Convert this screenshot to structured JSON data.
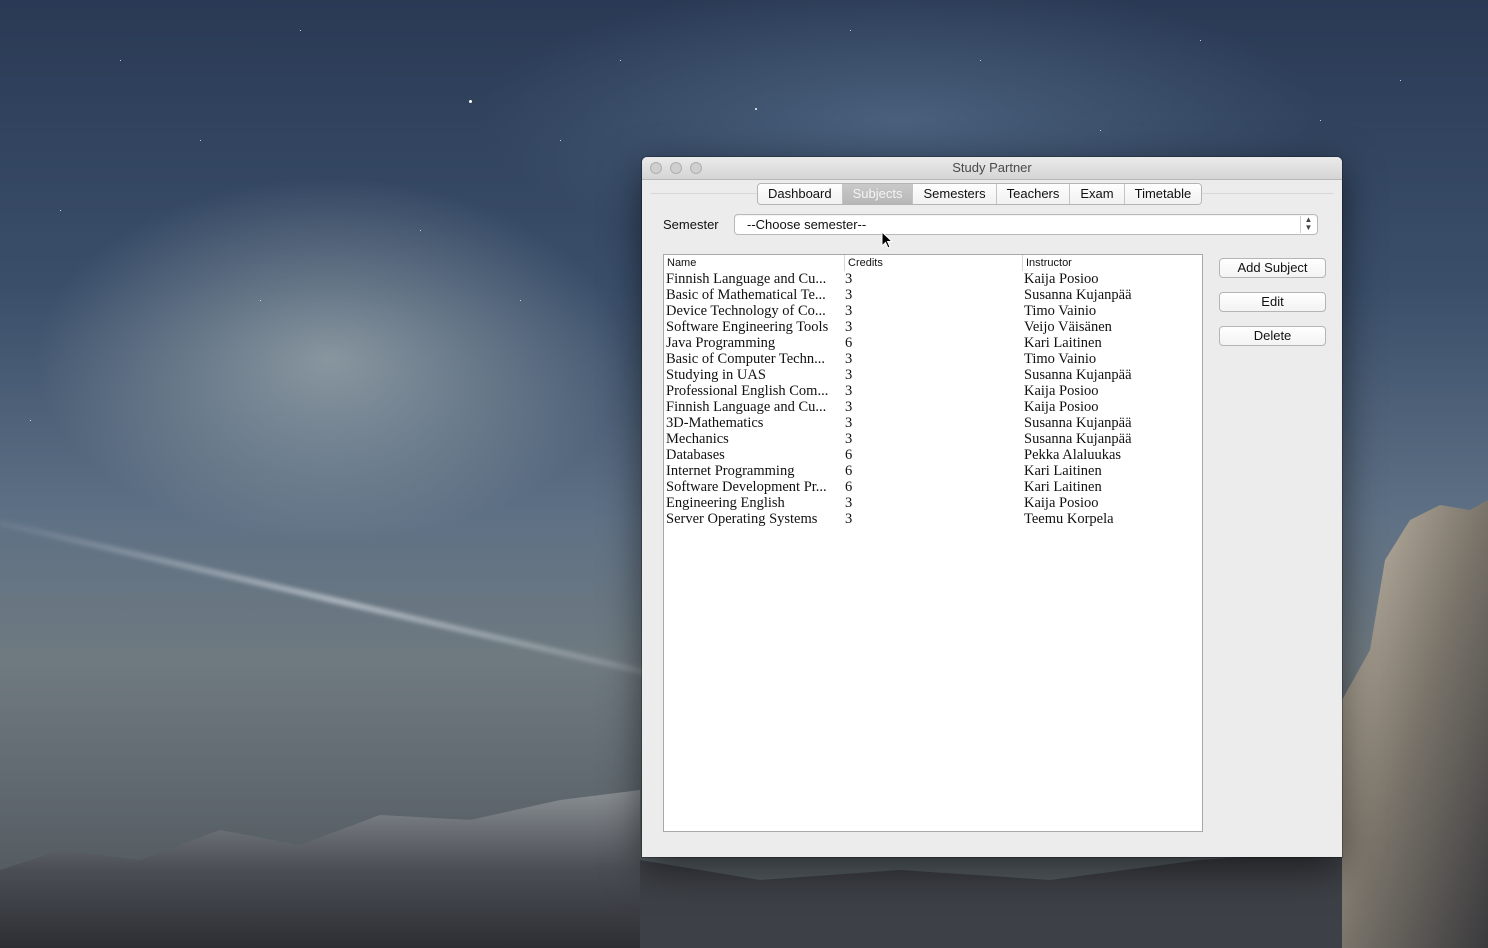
{
  "window": {
    "title": "Study Partner"
  },
  "tabs": [
    {
      "label": "Dashboard",
      "active": false
    },
    {
      "label": "Subjects",
      "active": true
    },
    {
      "label": "Semesters",
      "active": false
    },
    {
      "label": "Teachers",
      "active": false
    },
    {
      "label": "Exam",
      "active": false
    },
    {
      "label": "Timetable",
      "active": false
    }
  ],
  "semester": {
    "label": "Semester",
    "value": "--Choose semester--"
  },
  "table": {
    "headers": {
      "name": "Name",
      "credits": "Credits",
      "instructor": "Instructor"
    },
    "rows": [
      {
        "name": "Finnish Language and Cu...",
        "credits": "3",
        "instructor": "Kaija Posioo"
      },
      {
        "name": "Basic of Mathematical Te...",
        "credits": "3",
        "instructor": "Susanna Kujanpää"
      },
      {
        "name": "Device Technology of Co...",
        "credits": "3",
        "instructor": "Timo Vainio"
      },
      {
        "name": "Software Engineering Tools",
        "credits": "3",
        "instructor": "Veijo Väisänen"
      },
      {
        "name": "Java Programming",
        "credits": "6",
        "instructor": "Kari Laitinen"
      },
      {
        "name": "Basic of Computer Techn...",
        "credits": "3",
        "instructor": "Timo Vainio"
      },
      {
        "name": "Studying in UAS",
        "credits": "3",
        "instructor": "Susanna Kujanpää"
      },
      {
        "name": "Professional English Com...",
        "credits": "3",
        "instructor": "Kaija Posioo"
      },
      {
        "name": "Finnish Language and Cu...",
        "credits": "3",
        "instructor": "Kaija Posioo"
      },
      {
        "name": "3D-Mathematics",
        "credits": "3",
        "instructor": "Susanna Kujanpää"
      },
      {
        "name": "Mechanics",
        "credits": "3",
        "instructor": "Susanna Kujanpää"
      },
      {
        "name": "Databases",
        "credits": "6",
        "instructor": "Pekka Alaluukas"
      },
      {
        "name": "Internet Programming",
        "credits": "6",
        "instructor": "Kari Laitinen"
      },
      {
        "name": "Software Development Pr...",
        "credits": "6",
        "instructor": "Kari Laitinen"
      },
      {
        "name": "Engineering English",
        "credits": "3",
        "instructor": "Kaija Posioo"
      },
      {
        "name": "Server Operating Systems",
        "credits": "3",
        "instructor": "Teemu Korpela"
      }
    ]
  },
  "actions": {
    "add": "Add Subject",
    "edit": "Edit",
    "delete": "Delete"
  },
  "colors": {
    "active_tab": "#bdbdbd",
    "window_bg": "#ececec"
  }
}
